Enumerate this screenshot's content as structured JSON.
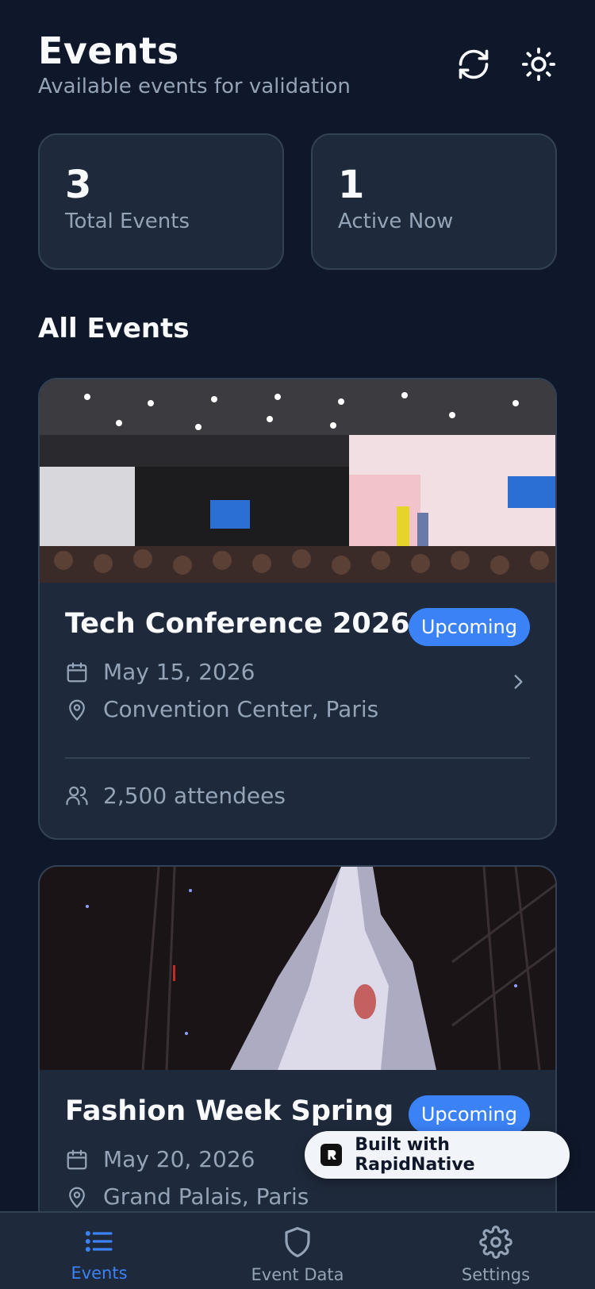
{
  "header": {
    "title": "Events",
    "subtitle": "Available events for validation"
  },
  "stats": [
    {
      "value": "3",
      "label": "Total Events"
    },
    {
      "value": "1",
      "label": "Active Now"
    }
  ],
  "section_title": "All Events",
  "events": [
    {
      "name": "Tech Conference 2026",
      "status": "Upcoming",
      "date": "May 15, 2026",
      "location": "Convention Center, Paris",
      "attendees": "2,500 attendees"
    },
    {
      "name": "Fashion Week Spring",
      "status": "Upcoming",
      "date": "May 20, 2026",
      "location": "Grand Palais, Paris"
    }
  ],
  "built_badge": "Built with RapidNative",
  "nav": {
    "items": [
      {
        "label": "Events",
        "icon": "list-icon",
        "active": true
      },
      {
        "label": "Event Data",
        "icon": "shield-icon",
        "active": false
      },
      {
        "label": "Settings",
        "icon": "gear-icon",
        "active": false
      }
    ]
  },
  "colors": {
    "background": "#0f172a",
    "card": "#1e293b",
    "border": "#334155",
    "accent": "#3b82f6",
    "muted_text": "#94a3b8"
  }
}
